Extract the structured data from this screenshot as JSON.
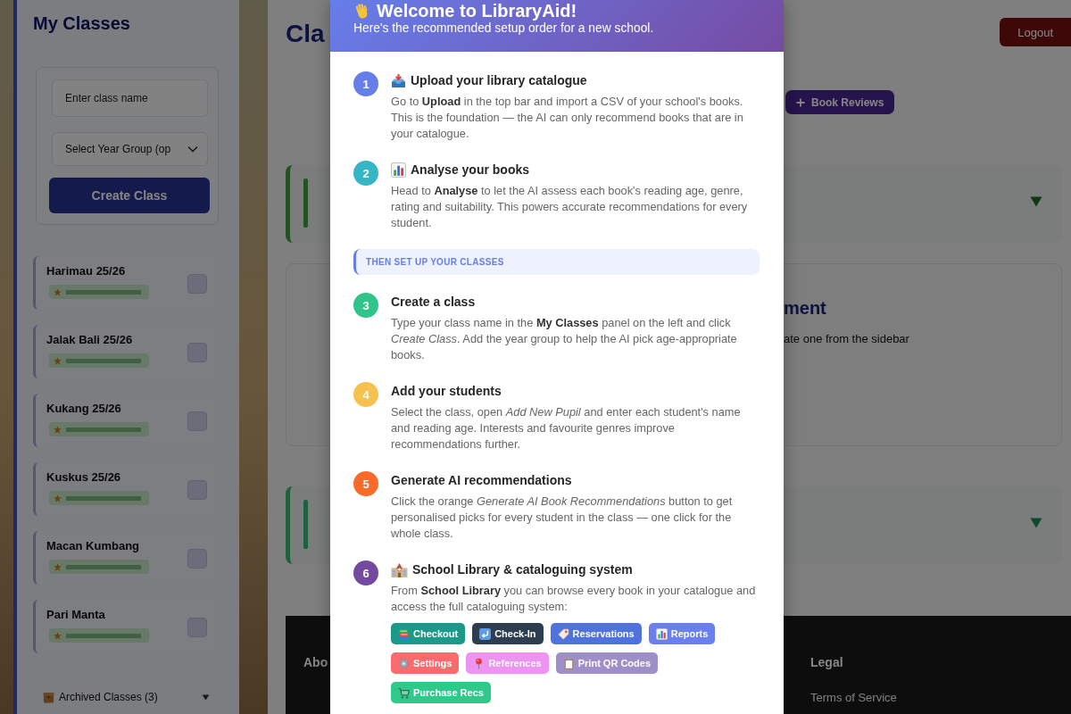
{
  "sidebar": {
    "title": "My Classes",
    "class_name_field": {
      "placeholder": "Enter class name"
    },
    "year_group_select": {
      "value": "Select Year Group (op"
    },
    "create_button": "Create Class",
    "classes": [
      {
        "name": "Harimau 25/26"
      },
      {
        "name": "Jalak Bali 25/26"
      },
      {
        "name": "Kukang 25/26"
      },
      {
        "name": "Kuskus 25/26"
      },
      {
        "name": "Macan Kumbang"
      },
      {
        "name": "Pari Manta"
      }
    ],
    "archived": {
      "label": "Archived Classes (3)",
      "expanded": false
    }
  },
  "main": {
    "heading": "Cla",
    "logout_button": "Logout",
    "book_reviews_button": "Book Reviews",
    "panel_heading": "ment",
    "panel_text": "ate one from the sidebar",
    "footer": {
      "columns": [
        {
          "heading": "Abo"
        },
        {
          "heading": "Legal",
          "links": [
            "Terms of Service"
          ]
        }
      ]
    }
  },
  "dialog": {
    "title": "Welcome to LibraryAid!",
    "subtitle": "Here's the recommended setup order for a new school.",
    "steps": [
      {
        "kind": "step",
        "number": "1",
        "color": "#667eea",
        "title": "Upload your library catalogue",
        "text": "Go to **Upload** in the top bar and import a CSV of your school's books. This is the foundation — the AI can only recommend books that are in your catalogue."
      },
      {
        "kind": "step",
        "number": "2",
        "color": "#36b5c6",
        "title": "Analyse your books",
        "text": "Head to **Analyse** to let the AI assess each book's reading age, genre, rating and suitability. This powers accurate recommendations for every student."
      },
      {
        "kind": "section",
        "label": "THEN SET UP YOUR CLASSES"
      },
      {
        "kind": "step",
        "number": "3",
        "color": "#2ec48c",
        "title": "Create a class",
        "text": "Type your class name in the **My Classes** panel on the left and click *Create Class*. Add the year group to help the AI pick age-appropriate books."
      },
      {
        "kind": "step",
        "number": "4",
        "color": "#f6c14f",
        "title": "Add your students",
        "text": "Select the class, open *Add New Pupil* and enter each student's name and reading age. Interests and favourite genres improve recommendations further."
      },
      {
        "kind": "step",
        "number": "5",
        "color": "#fc6a2a",
        "title": "Generate AI recommendations",
        "text": "Click the orange *Generate AI Book Recommendations* button to get personalised picks for every student in the class — one click for the whole class."
      },
      {
        "kind": "step",
        "number": "6",
        "color": "#734aa0",
        "title": "School Library & cataloguing system",
        "text": "From **School Library** you can browse every book in your catalogue and access the full cataloguing system:",
        "links": [
          {
            "label": "Checkout",
            "color": "#1b9a8a"
          },
          {
            "label": "Check-In",
            "color": "#2c3e50"
          },
          {
            "label": "Reservations",
            "color": "#4f72dc"
          },
          {
            "label": "Reports",
            "color": "#6b80ee"
          },
          {
            "label": "Settings",
            "color": "#fb6b6d"
          },
          {
            "label": "References",
            "color": "#ee93f2"
          },
          {
            "label": "Print QR Codes",
            "color": "#9f8fc9"
          },
          {
            "label": "Purchase Recs",
            "color": "#2ec98b"
          }
        ]
      }
    ]
  }
}
